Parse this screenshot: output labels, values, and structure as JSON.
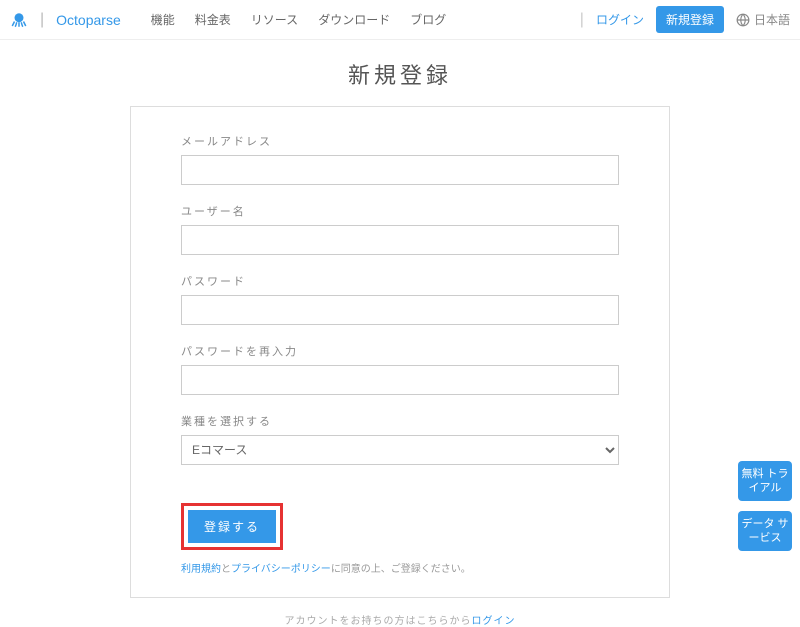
{
  "header": {
    "brand": "Octoparse",
    "nav": [
      "機能",
      "料金表",
      "リソース",
      "ダウンロード",
      "ブログ"
    ],
    "login": "ログイン",
    "register": "新規登録",
    "lang": "日本語"
  },
  "page": {
    "title": "新規登録"
  },
  "form": {
    "email_label": "メールアドレス",
    "email_value": "",
    "username_label": "ユーザー名",
    "username_value": "",
    "password_label": "パスワード",
    "password_value": "",
    "password2_label": "パスワードを再入力",
    "password2_value": "",
    "industry_label": "業種を選択する",
    "industry_selected": "Eコマース",
    "submit_label": "登録する",
    "terms_prefix": "",
    "terms_link1": "利用規約",
    "terms_middle": "と",
    "terms_link2": "プライバシーポリシー",
    "terms_suffix": "に同意の上、ご登録ください。"
  },
  "login_link": {
    "prefix": "アカウントをお持ちの方はこちらから",
    "link": "ログイン"
  },
  "float": {
    "trial": "無料\nトライアル",
    "data": "データ\nサービス"
  }
}
